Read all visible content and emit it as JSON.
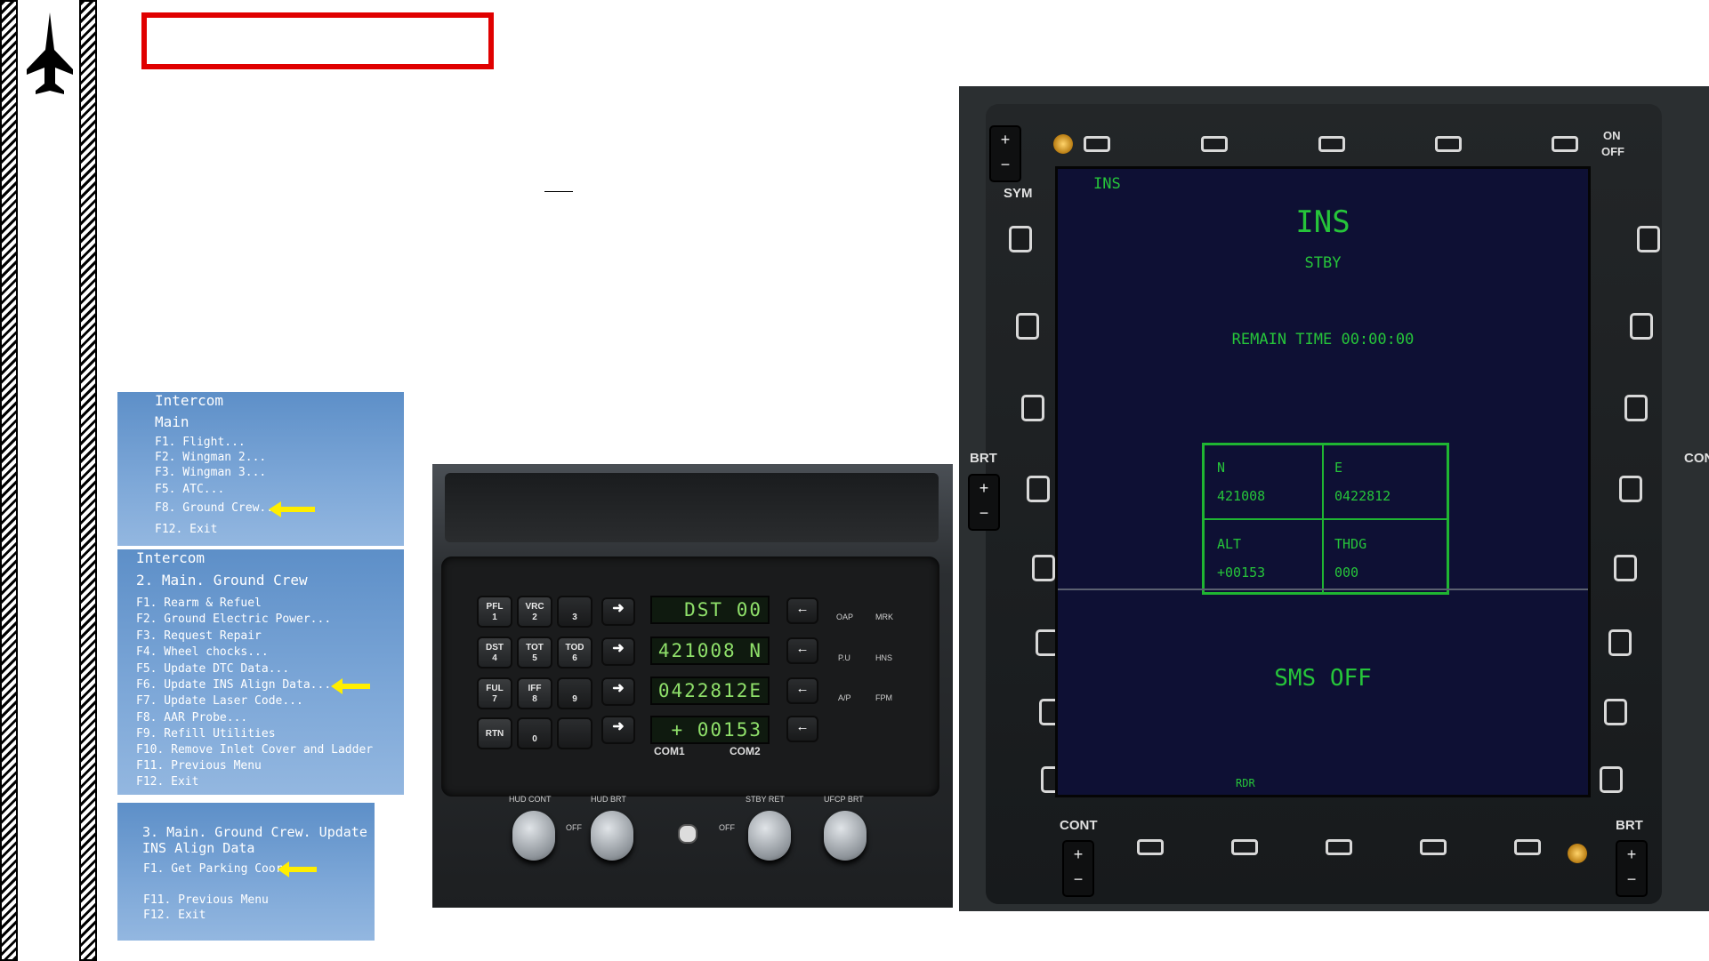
{
  "menus": [
    {
      "title1": "Intercom",
      "title2": "Main",
      "items": [
        "F1. Flight...",
        "F2. Wingman 2...",
        "F3. Wingman 3...",
        "F5. ATC...",
        "F8. Ground Crew...",
        "F12. Exit"
      ]
    },
    {
      "title1": "Intercom",
      "title2": "2. Main. Ground Crew",
      "items": [
        "F1. Rearm & Refuel",
        "F2. Ground Electric Power...",
        "F3. Request Repair",
        "F4. Wheel chocks...",
        "F5. Update DTC Data...",
        "F6. Update INS Align Data...",
        "F7. Update Laser Code...",
        "F8. AAR Probe...",
        "F9. Refill Utilities",
        "F10. Remove Inlet Cover and Ladder",
        "F11. Previous Menu",
        "F12. Exit"
      ]
    },
    {
      "title1": "3. Main. Ground Crew. Update",
      "title2": "INS Align Data",
      "items": [
        "F1. Get Parking Coord",
        "F11. Previous Menu",
        "F12. Exit"
      ]
    }
  ],
  "ufc": {
    "keys": [
      [
        "PFL",
        "1"
      ],
      [
        "VRC",
        "2"
      ],
      [
        "",
        "3"
      ],
      [
        "DST",
        "4"
      ],
      [
        "TOT",
        "5"
      ],
      [
        "TOD",
        "6"
      ],
      [
        "FUL",
        "7"
      ],
      [
        "IFF",
        "8"
      ],
      [
        "",
        "9"
      ],
      [
        "RTN",
        ""
      ],
      [
        "",
        "0"
      ],
      [
        "",
        ""
      ]
    ],
    "displays": [
      "DST    00",
      "421008 N",
      "0422812E",
      "+  00153"
    ],
    "right_labels": [
      "OAP",
      "MRK",
      "P.U",
      "HNS",
      "A/P",
      "FPM"
    ],
    "com1": "COM1",
    "com2": "COM2",
    "knobs": [
      "HUD CONT",
      "HUD BRT",
      "STBY RET",
      "UFCP BRT"
    ],
    "off": "OFF"
  },
  "mfd": {
    "page_label": "INS",
    "title": "INS",
    "status": "STBY",
    "remain": "REMAIN TIME 00:00:00",
    "cells": [
      {
        "label": "N",
        "value": "421008"
      },
      {
        "label": "E",
        "value": "0422812"
      },
      {
        "label": "ALT",
        "value": "+00153"
      },
      {
        "label": "THDG",
        "value": "000"
      }
    ],
    "sms": "SMS OFF",
    "bottom_label": "RDR",
    "bezel_labels": {
      "sym": "SYM",
      "brt_left": "BRT",
      "cont": "CONT",
      "brt_right": "BRT",
      "on": "ON",
      "off": "OFF",
      "con_partial": "CON"
    }
  },
  "colors": {
    "red_box": "#e00000",
    "menu_blue": "#7ea8d8",
    "mfd_green": "#26c43a",
    "ufc_green": "#8fe06a",
    "arrow_yellow": "#ffee00"
  },
  "icons": [
    "jet-silhouette-icon",
    "yellow-arrow-icon"
  ]
}
